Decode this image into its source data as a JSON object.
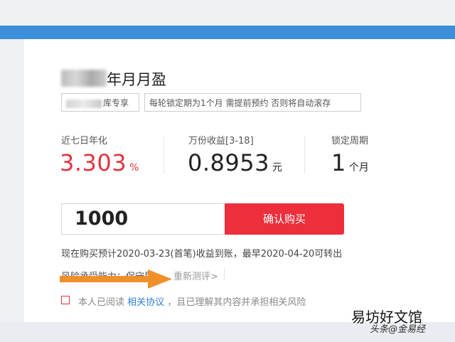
{
  "product": {
    "title": "年月月盈",
    "tag_exclusive": "库专享",
    "tag_rule": "每轮锁定期为1个月 需提前预约 否则将自动滚存"
  },
  "stats": {
    "annual": {
      "label": "近七日年化",
      "value": "3.303",
      "unit": "%"
    },
    "per_10k": {
      "label": "万份收益[3-18]",
      "value": "0.8953",
      "unit": "元"
    },
    "lock": {
      "label": "锁定周期",
      "value": "1",
      "unit": "个月"
    }
  },
  "purchase": {
    "amount": "1000",
    "confirm_label": "确认购买"
  },
  "info_text": "现在购买预计2020-03-23(首笔)收益到账，最早2020-04-20可转出",
  "risk": {
    "label": "风险承受能力：保守型",
    "reevaluate": "重新测评>"
  },
  "agreement": {
    "prefix": "本人已阅读",
    "link": "相关协议",
    "suffix": "，且已理解其内容并承担相关风险"
  },
  "watermark": {
    "main": "易坊好文馆",
    "sub": "头条@金易经"
  },
  "colors": {
    "accent_red": "#ec2f3b",
    "link_blue": "#2f7ed8",
    "header_blue": "#3c8fd9",
    "arrow_orange": "#f0902a"
  }
}
